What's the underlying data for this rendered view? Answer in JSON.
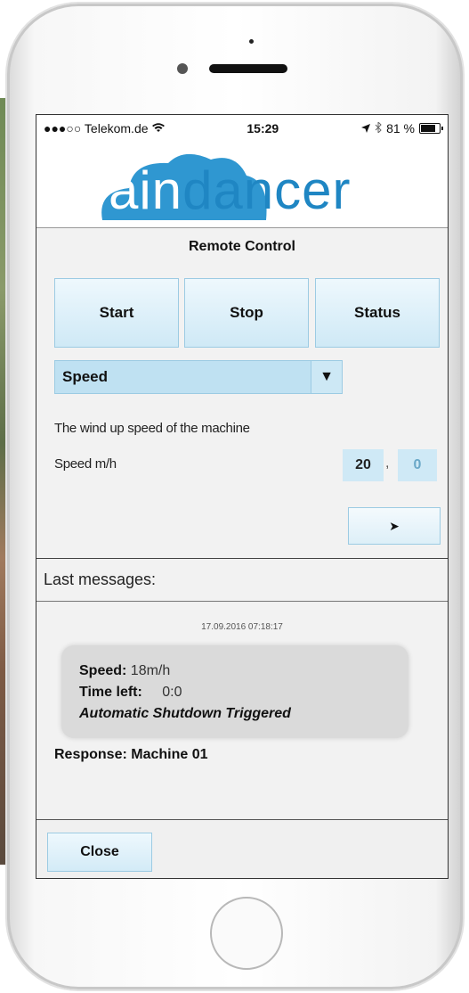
{
  "status_bar": {
    "carrier": "●●●○○ Telekom.de",
    "time": "15:29",
    "battery": "81 %"
  },
  "logo": {
    "text_part1": "rain",
    "text_part2": "dancer",
    "brand_color": "#1f86c3"
  },
  "remote": {
    "title": "Remote Control",
    "buttons": [
      "Start",
      "Stop",
      "Status"
    ],
    "select_value": "Speed",
    "description": "The wind up speed of the machine",
    "speed_label": "Speed m/h",
    "speed_int": "20",
    "separator": ",",
    "speed_dec": "0",
    "send_label": "➤"
  },
  "messages": {
    "header": "Last messages:",
    "timestamp": "17.09.2016 07:18:17",
    "speed_key": "Speed:",
    "speed_val": "18m/h",
    "time_key": "Time left:",
    "time_val": "0:0",
    "shutdown": "Automatic Shutdown Triggered",
    "response": "Response: Machine 01"
  },
  "footer": {
    "close_label": "Close"
  }
}
